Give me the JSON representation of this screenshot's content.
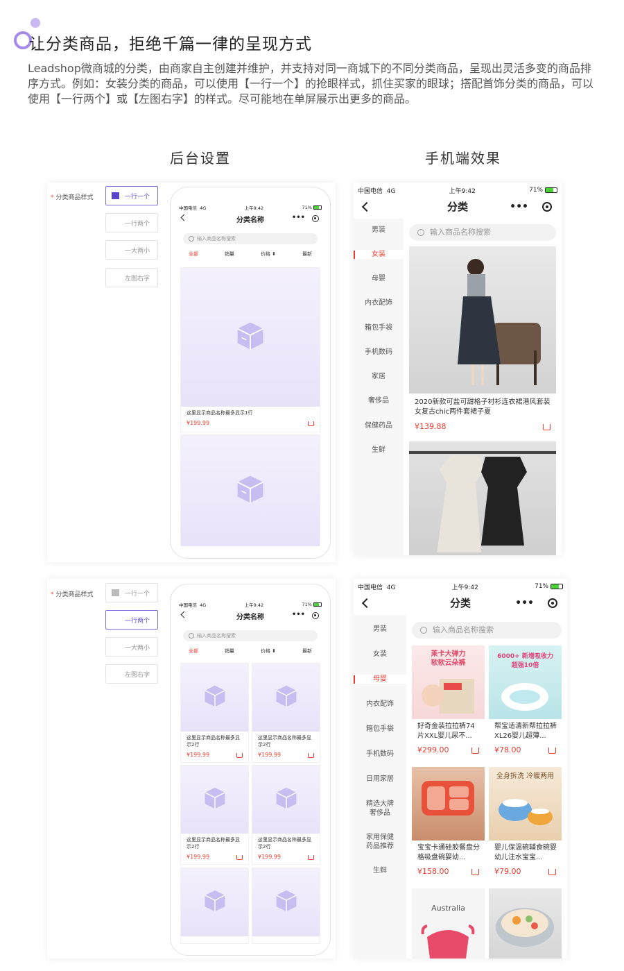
{
  "header": {
    "title": "让分类商品，拒绝千篇一律的呈现方式",
    "intro": "Leadshop微商城的分类，由商家自主创建并维护，并支持对同一商城下的不同分类商品，呈现出灵活多变的商品排序方式。例如：女装分类的商品，可以使用【一行一个】的抢眼样式，抓住买家的眼球；搭配首饰分类的商品，可以使用【一行两个】或【左图右字】的样式。尽可能地在单屏展示出更多的商品。"
  },
  "columns": {
    "admin": "后台设置",
    "mobile": "手机端效果"
  },
  "admin": {
    "required_mark": "*",
    "style_label": "分类商品样式",
    "options": [
      "一行一个",
      "一行两个",
      "一大两小",
      "左图右字"
    ],
    "preview": {
      "status_carrier": "中国电信",
      "status_network": "4G",
      "status_time": "上午9:42",
      "status_battery": "71%",
      "nav_title": "分类名称",
      "more_icon": "•••",
      "search_placeholder": "输入商品名称搜索",
      "tabs": [
        "全部",
        "销量",
        "价格 ⬍",
        "最新"
      ],
      "single_name": "这里显示商品名称最多显示1行",
      "double_name": "这里显示商品名称最多显示2行",
      "price": "¥199.99"
    }
  },
  "mobile1": {
    "status_carrier": "中国电信",
    "status_network": "4G",
    "status_time": "上午9:42",
    "status_battery": "71%",
    "nav_title": "分类",
    "more_icon": "•••",
    "search_placeholder": "输入商品名称搜索",
    "categories": [
      "男装",
      "女装",
      "母婴",
      "内衣配饰",
      "箱包手袋",
      "手机数码",
      "家居",
      "奢侈品",
      "保健药品",
      "生鲜"
    ],
    "active_index": 1,
    "products": [
      {
        "name": "2020新款可盐可甜格子衬衫连衣裙港风套装女复古chic两件套裙子夏",
        "price": "¥139.88"
      }
    ]
  },
  "mobile2": {
    "status_carrier": "中国电信",
    "status_network": "4G",
    "status_time": "上午9:42",
    "status_battery": "71%",
    "nav_title": "分类",
    "more_icon": "•••",
    "search_placeholder": "输入商品名称搜索",
    "categories": [
      "男装",
      "女装",
      "母婴",
      "内衣配饰",
      "箱包手袋",
      "手机数码",
      "日用家居",
      "精选大牌\n奢侈品",
      "家用保健\n药品推荐",
      "生鲜"
    ],
    "active_index": 2,
    "products": [
      {
        "name": "好奇金装拉拉裤74片XXL婴儿尿不...",
        "price": "¥299.00",
        "photo_text": "莱卡大弹力\n软软云朵裤"
      },
      {
        "name": "帮宝适清新帮拉拉裤XL26婴儿超薄...",
        "price": "¥78.00",
        "photo_text": "6000+ 新增吸收力\n超强10倍"
      },
      {
        "name": "宝宝卡通硅胶餐盘分格吸盘碗婴幼...",
        "price": "¥158.00",
        "photo_text": ""
      },
      {
        "name": "婴儿保温碗辅食碗婴幼儿注水宝宝...",
        "price": "¥79.00",
        "photo_text": "全身拆洗 冷暖两用"
      },
      {
        "name": "",
        "price": "",
        "photo_text": "Australia"
      }
    ]
  },
  "colors": {
    "accent": "#6b56d3",
    "price": "#ea3b2d",
    "placeholder": "#e8e2f9"
  }
}
